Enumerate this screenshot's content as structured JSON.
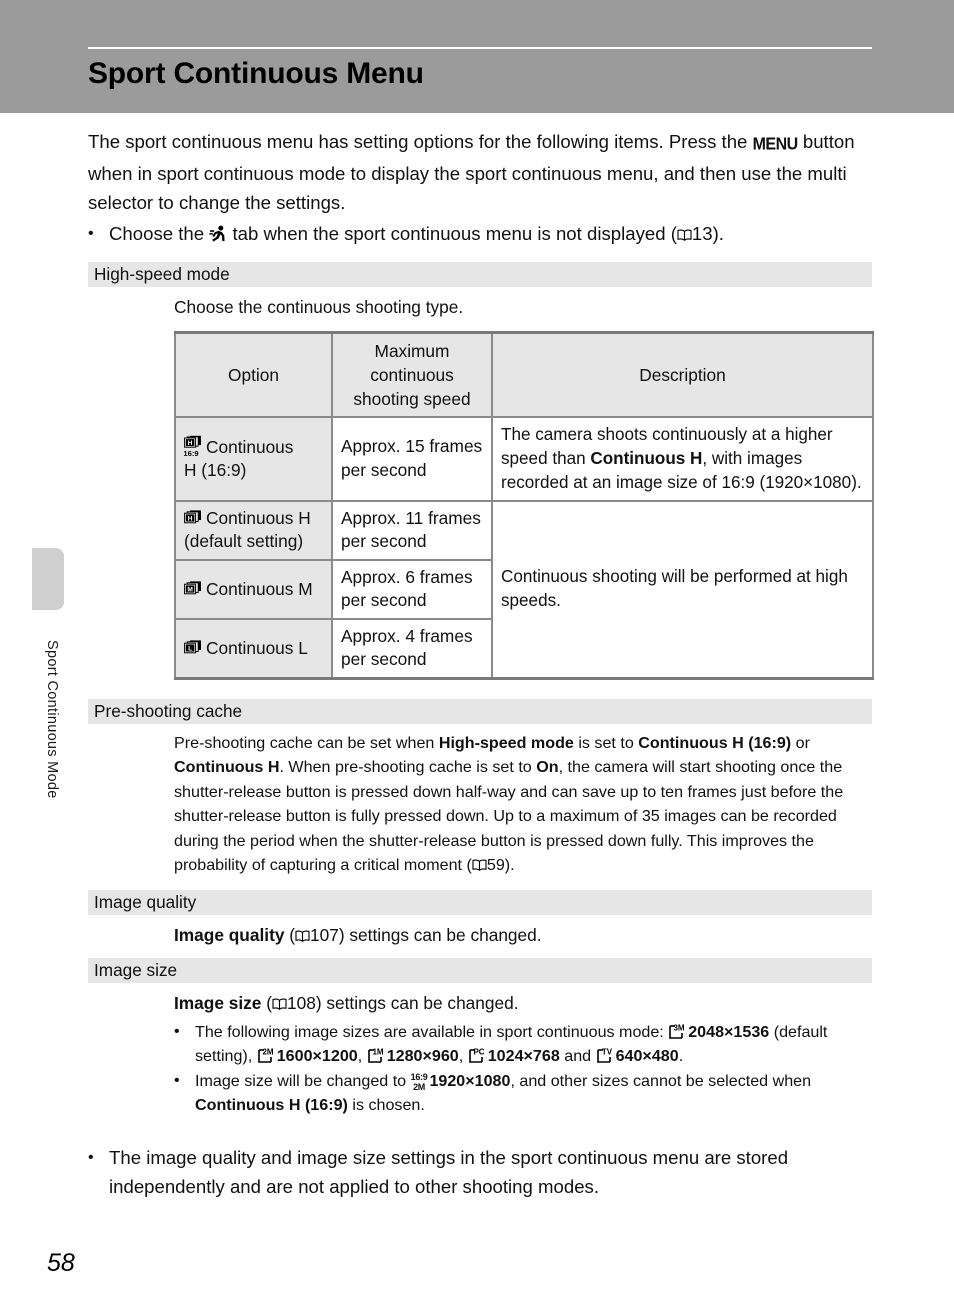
{
  "header": {
    "title": "Sport Continuous Menu"
  },
  "sidebar": {
    "vertical_label": "Sport Continuous Mode"
  },
  "footer": {
    "page_number": "58"
  },
  "intro": {
    "line1_before_menu": "The sport continuous menu has setting options for the following items. Press the ",
    "menu_icon_label": "MENU",
    "line1_after_menu": " button when in sport continuous mode to display the sport continuous menu, and then use the multi selector to change the settings.",
    "bullet_before_icon": "Choose the ",
    "sport_icon_name": "sport-running-icon",
    "bullet_after_icon": " tab when the sport continuous menu is not displayed (",
    "bullet_ref": "13",
    "bullet_end": ")."
  },
  "sections": {
    "high_speed_mode": {
      "heading": "High-speed mode",
      "lead": "Choose the continuous shooting type.",
      "table": {
        "headers": [
          "Option",
          "Maximum continuous shooting speed",
          "Description"
        ],
        "rows": [
          {
            "icon": "continuous-h-169-icon",
            "option_line1": "Continuous",
            "option_line2": "H (16:9)",
            "speed": "Approx. 15 frames per second",
            "desc_part1": "The camera shoots continuously at a higher speed than ",
            "desc_bold": "Continuous H",
            "desc_part2": ", with images recorded at an image size of 16:9 (1920×1080)."
          },
          {
            "icon": "continuous-h-icon",
            "option_line1": "Continuous H",
            "option_line2": "(default setting)",
            "speed": "Approx. 11 frames per second"
          },
          {
            "icon": "continuous-m-icon",
            "option_line1": "Continuous M",
            "option_line2": "",
            "speed": "Approx. 6 frames per second"
          },
          {
            "icon": "continuous-l-icon",
            "option_line1": "Continuous L",
            "option_line2": "",
            "speed": "Approx. 4 frames per second"
          }
        ],
        "merged_description": "Continuous shooting will be performed at high speeds."
      }
    },
    "pre_shooting_cache": {
      "heading": "Pre-shooting cache",
      "t1": "Pre-shooting cache can be set when ",
      "b1": "High-speed mode",
      "t2": " is set to ",
      "b2": "Continuous H (16:9)",
      "t3": " or ",
      "b3": "Continuous H",
      "t4": ". When pre-shooting cache is set to ",
      "b4": "On",
      "t5": ", the camera will start shooting once the shutter-release button is pressed down half-way and can save up to ten frames just before the shutter-release button is fully pressed down. Up to a maximum of 35 images can be recorded during the period when the shutter-release button is pressed down fully. This improves the probability of capturing a critical moment (",
      "ref": "59",
      "t6": ")."
    },
    "image_quality": {
      "heading": "Image quality",
      "bold": "Image quality",
      "t1": " (",
      "ref": "107",
      "t2": ") settings can be changed."
    },
    "image_size": {
      "heading": "Image size",
      "bold": "Image size",
      "t1": " (",
      "ref": "108",
      "t2": ") settings can be changed.",
      "bullet1": {
        "lead": "The following image sizes are available in sport continuous mode: ",
        "sizes": [
          {
            "icon_label": "3M",
            "value": "2048×1536",
            "suffix": " (default setting), "
          },
          {
            "icon_label": "2M",
            "value": "1600×1200",
            "suffix": ", "
          },
          {
            "icon_label": "1M",
            "value": "1280×960",
            "suffix": ", "
          },
          {
            "icon_label": "PC",
            "value": "1024×768",
            "suffix": " and "
          },
          {
            "icon_label": "TV",
            "value": "640×480",
            "suffix": "."
          }
        ]
      },
      "bullet2": {
        "t1": "Image size will be changed to ",
        "icon_top": "16:9",
        "icon_bottom": "2M",
        "value": "1920×1080",
        "t2": ", and other sizes cannot be selected when ",
        "bold": "Continuous H (16:9)",
        "t3": " is chosen."
      }
    }
  },
  "closing_bullet": {
    "text": "The image quality and image size settings in the sport continuous menu are stored independently and are not applied to other shooting modes."
  },
  "colors": {
    "header_band": "#9b9b9b",
    "section_bar": "#e6e6e6",
    "table_border": "#8a8a8a",
    "side_tab": "#cfcfcf"
  }
}
